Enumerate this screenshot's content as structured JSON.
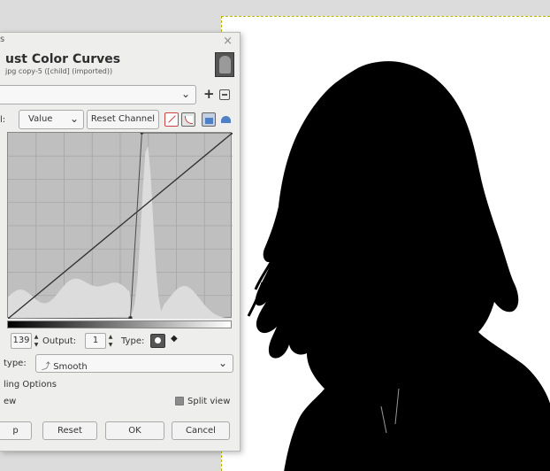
{
  "dialog": {
    "close_glyph": "×",
    "title_stub": "s",
    "heading": "ust Color Curves",
    "subtitle": "jpg copy-5 ([child] (imported))"
  },
  "presets": {
    "add_glyph": "+",
    "value": ""
  },
  "channel": {
    "label": "l:",
    "value": "Value",
    "reset_label": "Reset Channel"
  },
  "graph": {
    "control_points": [
      {
        "input": 0,
        "output": 0
      },
      {
        "input": 139,
        "output": 1
      },
      {
        "input": 152,
        "output": 255
      },
      {
        "input": 255,
        "output": 255
      }
    ],
    "reference_line": [
      [
        0,
        0
      ],
      [
        255,
        255
      ]
    ]
  },
  "point_editor": {
    "input_value": "139",
    "output_label": "Output:",
    "output_value": "1",
    "type_label": "Type:",
    "corner_glyph": "◆"
  },
  "curve_type": {
    "label": "type:",
    "value": "Smooth",
    "icon_glyph": "⤴"
  },
  "blending_options": {
    "label": "ling Options"
  },
  "preview": {
    "label": "ew"
  },
  "split_view": {
    "label": "Split view",
    "checked": true
  },
  "buttons": {
    "help": "p",
    "reset": "Reset",
    "ok": "OK",
    "cancel": "Cancel"
  },
  "colors": {
    "curve": "#4a4a4a",
    "reference": "#2f2f2f",
    "histogram": "#dcdcdc",
    "graph_bg": "#bfbfbf"
  }
}
